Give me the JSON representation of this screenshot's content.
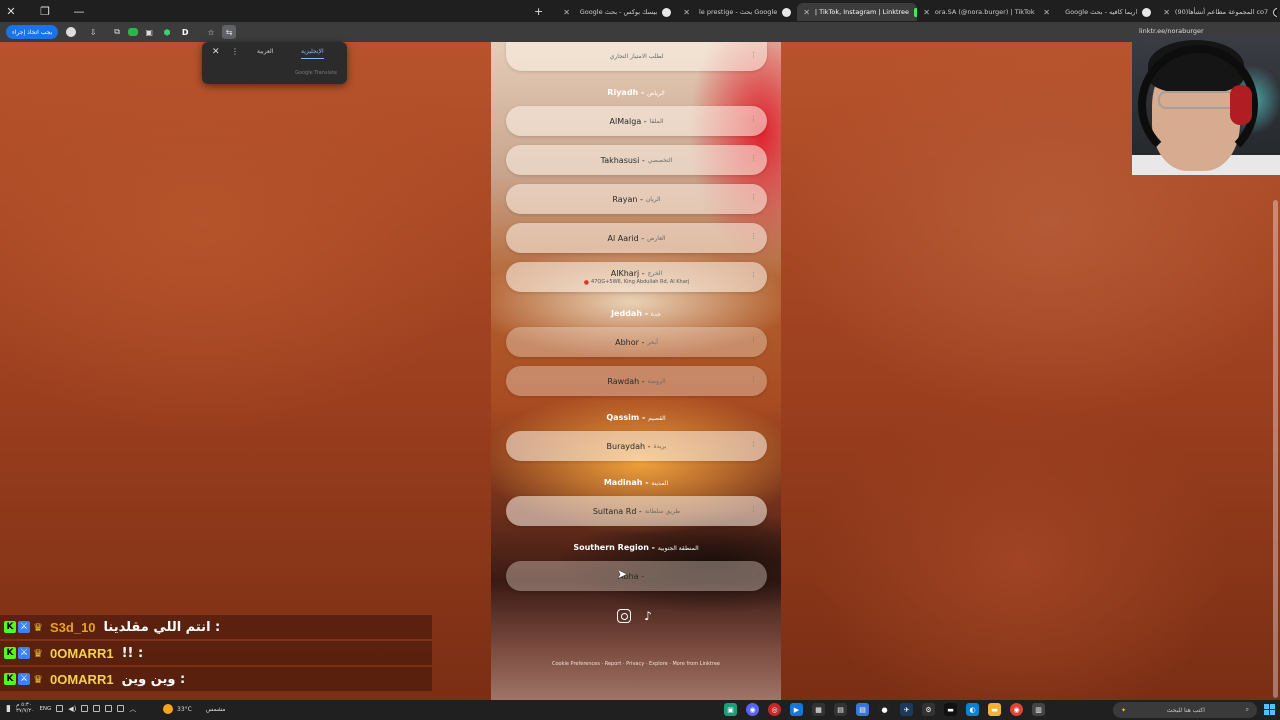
{
  "browser": {
    "tabs": [
      {
        "title": "Google بيسك بوكس - بحث",
        "icon": "google-icon"
      },
      {
        "title": "le prestige - بحث Google",
        "icon": "google-icon"
      },
      {
        "title": "| TikTok, Instagram | Linktree",
        "icon": "linktree-icon",
        "active": true
      },
      {
        "title": "ora.SA (@nora.burger) | TikTok",
        "icon": "tiktok-icon"
      },
      {
        "title": "Google اريما كافيه - بحث",
        "icon": "google-icon"
      },
      {
        "title": "(90)المجموعة مطاعم أنشأها co7",
        "icon": "tiktok-icon"
      }
    ],
    "new_tab_label": "+",
    "relaunch_label": "يجب اتخاذ إجراء",
    "url": "linktr.ee/noraburger",
    "profile_initial": "D"
  },
  "translate_popup": {
    "lang_english": "الإنجليزية",
    "lang_arabic": "العربية",
    "brand": "Google Translate"
  },
  "links": {
    "top_partial": {
      "label": "لطلب الامتياز التجاري"
    },
    "riyadh": {
      "heading": "Riyadh -",
      "heading_ar": "الرياض",
      "items": [
        {
          "en": "AlMalga -",
          "ar": "الملقا"
        },
        {
          "en": "Takhasusi -",
          "ar": "التخصصي"
        },
        {
          "en": "Rayan -",
          "ar": "الريان"
        },
        {
          "en": "Al Aarid -",
          "ar": "العارض"
        },
        {
          "en": "AlKharj -",
          "ar": "الخرج",
          "sub": "47QG+5W6, King Abdullah Rd, Al Kharj"
        }
      ]
    },
    "jeddah": {
      "heading": "Jeddah -",
      "heading_ar": "جدة",
      "items": [
        {
          "en": "Abhor -",
          "ar": "أبحر"
        },
        {
          "en": "Rawdah -",
          "ar": "الروضة"
        }
      ]
    },
    "qassim": {
      "heading": "Qassim -",
      "heading_ar": "القصيم",
      "items": [
        {
          "en": "Buraydah -",
          "ar": "بريدة"
        }
      ]
    },
    "madinah": {
      "heading": "Madinah -",
      "heading_ar": "المدينة",
      "items": [
        {
          "en": "Sultana Rd -",
          "ar": "طريق سلطانة"
        }
      ]
    },
    "southern": {
      "heading": "Southern Region -",
      "heading_ar": "المنطقة الجنوبية",
      "items": [
        {
          "en": "Abha -",
          "ar": "أبها"
        }
      ]
    }
  },
  "footer": {
    "text": "Cookie Preferences · Report · Privacy · Explore · More from Linktree"
  },
  "chat": [
    {
      "user": "S3d_10",
      "user_color": "#e8a317",
      "message": "انتم اللي مقلدينا :"
    },
    {
      "user": "0OMARR1",
      "user_color": "#f4d24a",
      "message": "!! :"
    },
    {
      "user": "0OMARR1",
      "user_color": "#f4d24a",
      "message": "وين وين :"
    }
  ],
  "taskbar": {
    "time": "٥:٣٠ م",
    "date": "٣٧/٧/٢٠",
    "lang": "ENG",
    "weather_temp": "33°C",
    "weather_text": "مشمس",
    "search_placeholder": "اكتب هنا للبحث"
  },
  "colors": {
    "kick_green": "#53fc18",
    "chrome_blue": "#1a73e8"
  }
}
